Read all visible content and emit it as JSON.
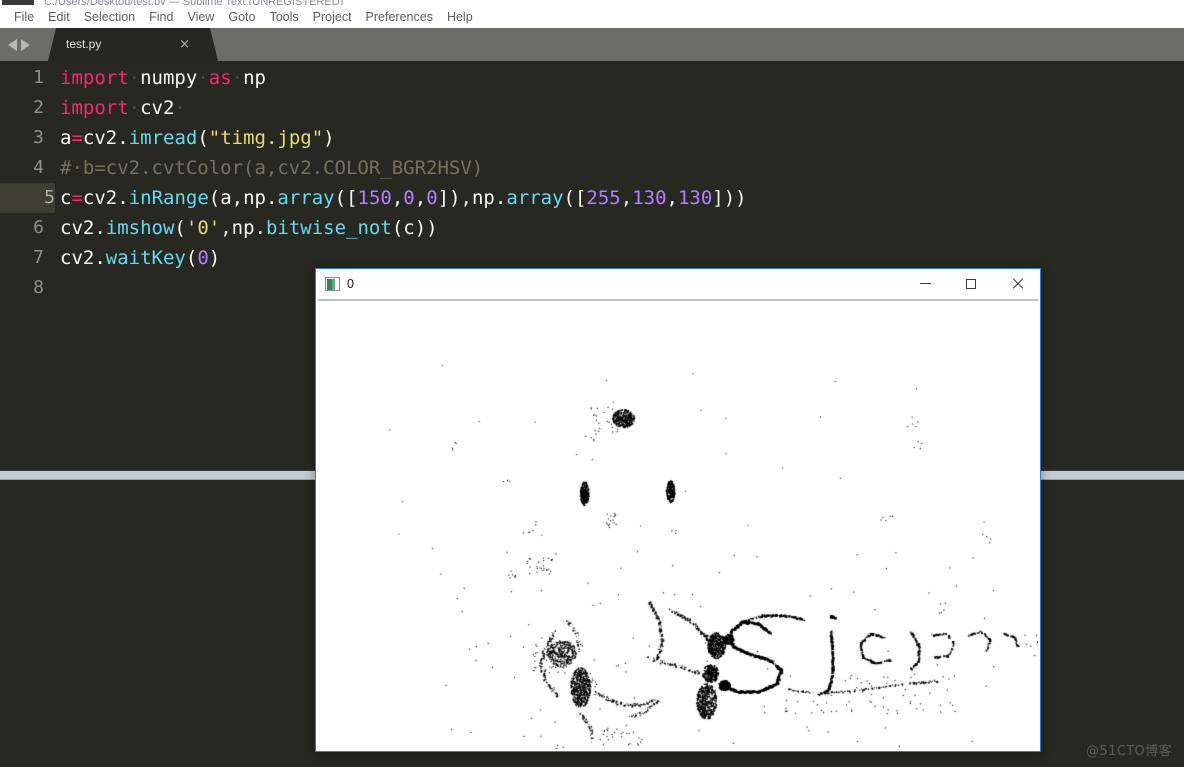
{
  "os_sliver": {
    "ghost_text": "C:/Users/Desktop/test.py — Sublime Text (UNREGISTERED)"
  },
  "menubar": {
    "items": [
      {
        "label": "File"
      },
      {
        "label": "Edit"
      },
      {
        "label": "Selection"
      },
      {
        "label": "Find"
      },
      {
        "label": "View"
      },
      {
        "label": "Goto"
      },
      {
        "label": "Tools"
      },
      {
        "label": "Project"
      },
      {
        "label": "Preferences"
      },
      {
        "label": "Help"
      }
    ]
  },
  "tabbar": {
    "prev_icon": "triangle-left-icon",
    "next_icon": "triangle-right-icon",
    "tab": {
      "label": "test.py",
      "close_label": "×"
    }
  },
  "editor": {
    "active_line": 5,
    "line_numbers": [
      "1",
      "2",
      "3",
      "4",
      "5",
      "6",
      "7",
      "8"
    ],
    "lines": [
      {
        "number": "1",
        "tokens": [
          {
            "t": "import",
            "c": "tok-kw"
          },
          {
            "t": "·",
            "c": "tok-ws"
          },
          {
            "t": "numpy",
            "c": "tok-plain"
          },
          {
            "t": "·",
            "c": "tok-ws"
          },
          {
            "t": "as",
            "c": "tok-kw"
          },
          {
            "t": "·",
            "c": "tok-ws"
          },
          {
            "t": "np",
            "c": "tok-plain"
          }
        ]
      },
      {
        "number": "2",
        "tokens": [
          {
            "t": "import",
            "c": "tok-kw"
          },
          {
            "t": "·",
            "c": "tok-ws"
          },
          {
            "t": "cv2",
            "c": "tok-plain"
          },
          {
            "t": "·",
            "c": "tok-ws"
          }
        ]
      },
      {
        "number": "3",
        "tokens": [
          {
            "t": "a",
            "c": "tok-plain"
          },
          {
            "t": "=",
            "c": "tok-op"
          },
          {
            "t": "cv2",
            "c": "tok-plain"
          },
          {
            "t": ".",
            "c": "tok-dot"
          },
          {
            "t": "imread",
            "c": "tok-fn"
          },
          {
            "t": "(",
            "c": "tok-plain"
          },
          {
            "t": "\"timg.jpg\"",
            "c": "tok-str"
          },
          {
            "t": ")",
            "c": "tok-plain"
          }
        ]
      },
      {
        "number": "4",
        "tokens": [
          {
            "t": "#·b=cv2.cvtColor(a,cv2.COLOR_BGR2HSV)",
            "c": "tok-comment"
          }
        ]
      },
      {
        "number": "5",
        "tokens": [
          {
            "t": "c",
            "c": "tok-plain"
          },
          {
            "t": "=",
            "c": "tok-op"
          },
          {
            "t": "cv2",
            "c": "tok-plain"
          },
          {
            "t": ".",
            "c": "tok-dot"
          },
          {
            "t": "inRange",
            "c": "tok-fn"
          },
          {
            "t": "(a,np",
            "c": "tok-plain"
          },
          {
            "t": ".",
            "c": "tok-dot"
          },
          {
            "t": "array",
            "c": "tok-fn"
          },
          {
            "t": "([",
            "c": "tok-plain"
          },
          {
            "t": "150",
            "c": "tok-num"
          },
          {
            "t": ",",
            "c": "tok-plain"
          },
          {
            "t": "0",
            "c": "tok-num"
          },
          {
            "t": ",",
            "c": "tok-plain"
          },
          {
            "t": "0",
            "c": "tok-num"
          },
          {
            "t": "]),np",
            "c": "tok-plain"
          },
          {
            "t": ".",
            "c": "tok-dot"
          },
          {
            "t": "array",
            "c": "tok-fn"
          },
          {
            "t": "([",
            "c": "tok-plain"
          },
          {
            "t": "255",
            "c": "tok-num"
          },
          {
            "t": ",",
            "c": "tok-plain"
          },
          {
            "t": "130",
            "c": "tok-num"
          },
          {
            "t": ",",
            "c": "tok-plain"
          },
          {
            "t": "130",
            "c": "tok-num"
          },
          {
            "t": "]))",
            "c": "tok-plain"
          }
        ]
      },
      {
        "number": "6",
        "tokens": [
          {
            "t": "cv2",
            "c": "tok-plain"
          },
          {
            "t": ".",
            "c": "tok-dot"
          },
          {
            "t": "imshow",
            "c": "tok-fn"
          },
          {
            "t": "(",
            "c": "tok-plain"
          },
          {
            "t": "'0'",
            "c": "tok-str"
          },
          {
            "t": ",np",
            "c": "tok-plain"
          },
          {
            "t": ".",
            "c": "tok-dot"
          },
          {
            "t": "bitwise_not",
            "c": "tok-fn"
          },
          {
            "t": "(c))",
            "c": "tok-plain"
          }
        ]
      },
      {
        "number": "7",
        "tokens": [
          {
            "t": "cv2",
            "c": "tok-plain"
          },
          {
            "t": ".",
            "c": "tok-dot"
          },
          {
            "t": "waitKey",
            "c": "tok-fn"
          },
          {
            "t": "(",
            "c": "tok-plain"
          },
          {
            "t": "0",
            "c": "tok-num"
          },
          {
            "t": ")",
            "c": "tok-plain"
          }
        ]
      },
      {
        "number": "8",
        "tokens": []
      }
    ]
  },
  "image_window": {
    "title": "0",
    "icon": "picture-icon",
    "minimize_label": "minimize-icon",
    "maximize_label": "maximize-icon",
    "close_label": "close-icon"
  },
  "watermark": {
    "text": "@51CTO博客"
  },
  "colors": {
    "editor_bg": "#272822",
    "gutter_active": "#3e3d32",
    "tabbar_bg": "#6d6d68",
    "tab_active_bg": "#262622",
    "menubar_bg": "#ffffff",
    "menu_text": "#5c6066",
    "keyword": "#f92672",
    "function": "#66d9ef",
    "string": "#e6db74",
    "number": "#ae81ff",
    "comment": "#75715e",
    "plain_text": "#f8f8f2",
    "window_border": "#2c7fd1",
    "window_bg": "#ffffff",
    "mask_fg": "#000000",
    "watermark": "#5e5e58"
  }
}
